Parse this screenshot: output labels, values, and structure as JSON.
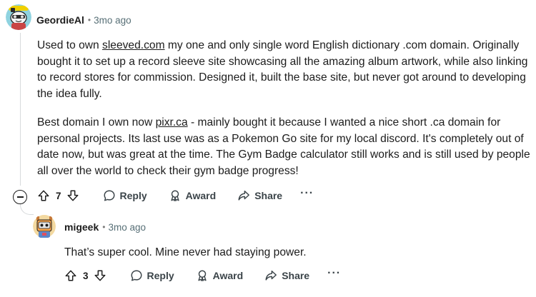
{
  "comments": [
    {
      "username": "GeordieAl",
      "separator": "•",
      "timestamp": "3mo ago",
      "paragraphs": [
        {
          "before": "Used to own ",
          "link": "sleeved.com",
          "after": " my one and only single word English dictionary .com domain. Originally bought it to set up a record sleeve site showcasing all the amazing album artwork, while also linking to record stores for commission. Designed it, built the base site, but never got around to developing the idea fully."
        },
        {
          "before": "Best domain I own now ",
          "link": "pixr.ca",
          "after": " - mainly bought it because I wanted a nice short .ca domain for personal projects. Its last use was as a Pokemon Go site for my local discord. It's completely out of date now, but was great at the time. The Gym Badge calculator still works and is still used by people all over the world to check their gym badge progress!"
        }
      ],
      "votes": "7",
      "actions": {
        "reply": "Reply",
        "award": "Award",
        "share": "Share",
        "more": "···"
      }
    },
    {
      "username": "migeek",
      "separator": "•",
      "timestamp": "3mo ago",
      "text": "That’s super cool. Mine never had staying power.",
      "votes": "3",
      "actions": {
        "reply": "Reply",
        "award": "Award",
        "share": "Share",
        "more": "···"
      }
    }
  ],
  "colors": {
    "text": "#1c1c1c",
    "meta": "#576f76",
    "action": "#3b4449",
    "thread_line": "#d7dadc",
    "avatar1_bg": "#8fd3e0",
    "avatar2_bg": "#f3d9a0"
  },
  "icons": {
    "collapse": "collapse-icon",
    "upvote": "upvote-arrow-icon",
    "downvote": "downvote-arrow-icon",
    "reply": "speech-bubble-icon",
    "award": "award-ribbon-icon",
    "share": "share-arrow-icon",
    "more": "more-options-icon"
  }
}
